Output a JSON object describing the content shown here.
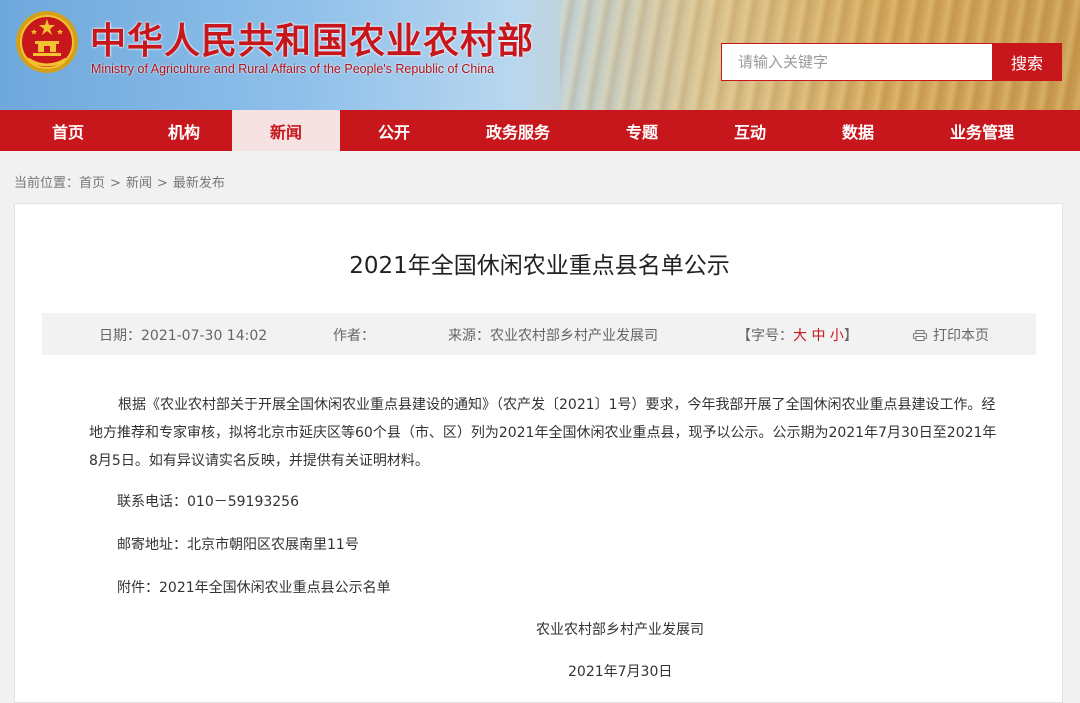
{
  "header": {
    "title": "中华人民共和国农业农村部",
    "subtitle": "Ministry of Agriculture and Rural Affairs of the People's Republic of China",
    "search_placeholder": "请输入关键字",
    "search_button": "搜索",
    "emblem_icon": "national-emblem-icon"
  },
  "nav": {
    "items": [
      {
        "label": "首页"
      },
      {
        "label": "机构"
      },
      {
        "label": "新闻"
      },
      {
        "label": "公开"
      },
      {
        "label": "政务服务"
      },
      {
        "label": "专题"
      },
      {
        "label": "互动"
      },
      {
        "label": "数据"
      },
      {
        "label": "业务管理"
      }
    ],
    "active_index": 2
  },
  "breadcrumb": {
    "prefix": "当前位置：",
    "items": [
      "首页",
      "新闻",
      "最新发布"
    ],
    "separator": ">"
  },
  "article": {
    "title": "2021年全国休闲农业重点县名单公示",
    "meta": {
      "date": "日期：2021-07-30 14:02",
      "author": "作者：",
      "source": "来源：农业农村部乡村产业发展司",
      "font_size_prefix": "【字号：",
      "font_large": "大",
      "font_medium": "中",
      "font_small": "小",
      "font_size_suffix": "】",
      "print": "打印本页"
    },
    "body": "根据《农业农村部关于开展全国休闲农业重点县建设的通知》（农产发〔2021〕1号）要求，今年我部开展了全国休闲农业重点县建设工作。经地方推荐和专家审核，拟将北京市延庆区等60个县（市、区）列为2021年全国休闲农业重点县，现予以公示。公示期为2021年7月30日至2021年8月5日。如有异议请实名反映，并提供有关证明材料。",
    "phone": "联系电话：010－59193256",
    "address": "邮寄地址：北京市朝阳区农展南里11号",
    "attachment": "附件：2021年全国休闲农业重点县公示名单",
    "signature": "农业农村部乡村产业发展司",
    "sign_date": "2021年7月30日"
  },
  "colors": {
    "brand_red": "#c8161d",
    "active_tab_bg": "#f6e2e2"
  }
}
